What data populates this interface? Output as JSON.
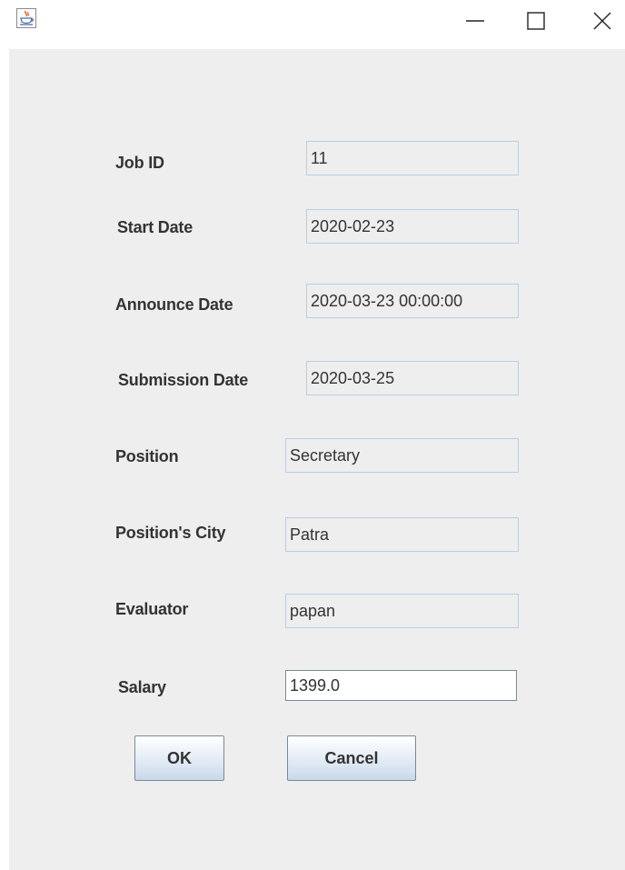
{
  "titlebar": {
    "icon": "java-cup-icon",
    "controls": {
      "minimize": "minimize-icon",
      "maximize": "maximize-icon",
      "close": "close-icon"
    }
  },
  "form": {
    "job_id": {
      "label": "Job ID",
      "value": "11"
    },
    "start_date": {
      "label": "Start Date",
      "value": "2020-02-23"
    },
    "announce_date": {
      "label": "Announce Date",
      "value": "2020-03-23 00:00:00"
    },
    "submission_date": {
      "label": "Submission Date",
      "value": "2020-03-25"
    },
    "position": {
      "label": "Position",
      "value": "Secretary"
    },
    "position_city": {
      "label": "Position's City",
      "value": "Patra"
    },
    "evaluator": {
      "label": "Evaluator",
      "value": "papan"
    },
    "salary": {
      "label": "Salary",
      "value": "1399.0"
    }
  },
  "buttons": {
    "ok": "OK",
    "cancel": "Cancel"
  },
  "colors": {
    "panel_bg": "#eeeeee",
    "field_border": "#b8cfe5",
    "text": "#333333"
  }
}
